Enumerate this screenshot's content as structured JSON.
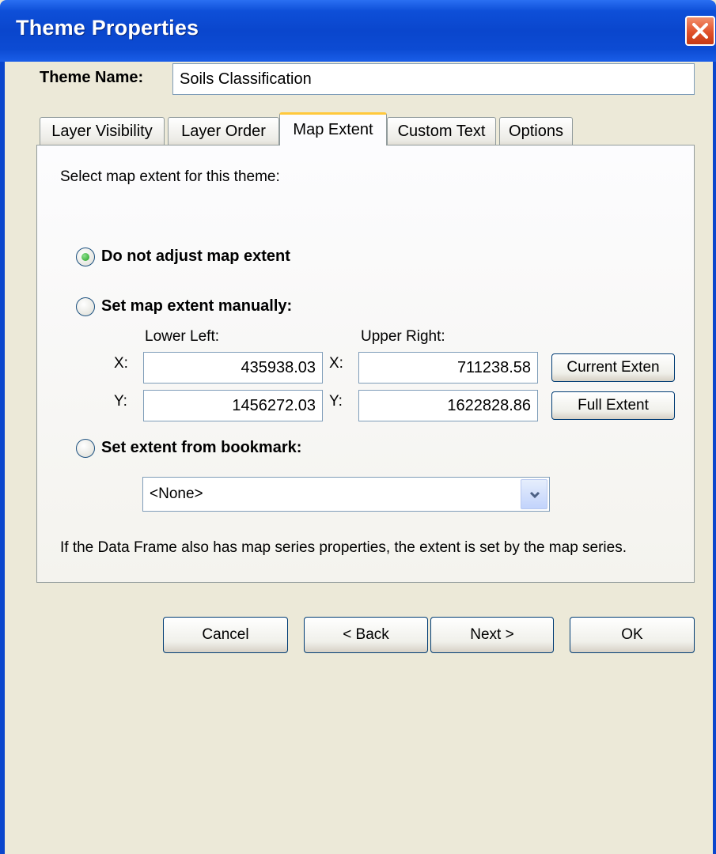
{
  "window": {
    "title": "Theme Properties"
  },
  "theme_name": {
    "label": "Theme Name:",
    "value": "Soils Classification"
  },
  "tabs": [
    {
      "label": "Layer Visibility",
      "active": false
    },
    {
      "label": "Layer Order",
      "active": false
    },
    {
      "label": "Map Extent",
      "active": true
    },
    {
      "label": "Custom Text",
      "active": false
    },
    {
      "label": "Options",
      "active": false
    }
  ],
  "map_extent": {
    "instruction": "Select map extent for this theme:",
    "options": {
      "no_adjust": {
        "label": "Do not adjust map extent",
        "selected": true
      },
      "manual": {
        "label": "Set map extent manually:",
        "selected": false
      },
      "bookmark": {
        "label": "Set extent from bookmark:",
        "selected": false
      }
    },
    "lower_left_label": "Lower Left:",
    "upper_right_label": "Upper Right:",
    "x_label": "X:",
    "y_label": "Y:",
    "lower_left_x": "435938.03",
    "lower_left_y": "1456272.03",
    "upper_right_x": "711238.58",
    "upper_right_y": "1622828.86",
    "current_extent_button": "Current Exten",
    "full_extent_button": "Full Extent",
    "bookmark_value": "<None>",
    "note": "If the Data Frame also has map series properties, the extent is set by the map series."
  },
  "footer": {
    "cancel": "Cancel",
    "back": "< Back",
    "next": "Next >",
    "ok": "OK"
  },
  "colors": {
    "titlebar": "#0a46cd",
    "window_bg": "#ece9d8",
    "active_tab_accent": "#ffc83c",
    "radio_dot": "#21a121",
    "close_button": "#e0512a"
  }
}
